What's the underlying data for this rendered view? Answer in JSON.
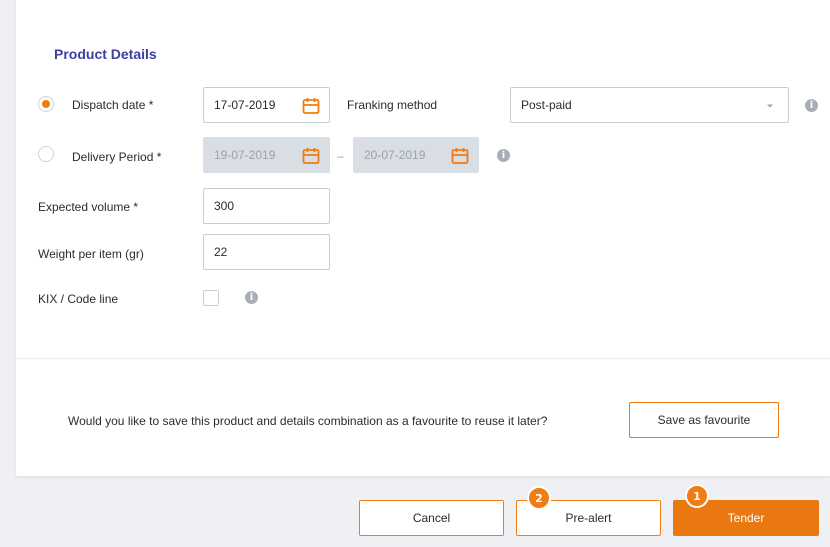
{
  "section": {
    "title": "Product Details"
  },
  "dispatch": {
    "label": "Dispatch date *",
    "value": "17-07-2019",
    "selected": true
  },
  "franking": {
    "label": "Franking method",
    "value": "Post-paid"
  },
  "delivery": {
    "label": "Delivery Period *",
    "from": "19-07-2019",
    "separator": "–",
    "to": "20-07-2019",
    "selected": false
  },
  "volume": {
    "label": "Expected volume *",
    "value": "300"
  },
  "weight": {
    "label": "Weight per item (gr)",
    "value": "22"
  },
  "kix": {
    "label": "KIX / Code line",
    "checked": false
  },
  "favourite": {
    "prompt": "Would you like to save this product and details combination as a favourite to reuse it later?",
    "button": "Save as favourite"
  },
  "actions": {
    "cancel": "Cancel",
    "prealert": "Pre-alert",
    "prealert_badge": "2",
    "tender": "Tender",
    "tender_badge": "1"
  },
  "icons": {
    "info": "i"
  },
  "colors": {
    "accent": "#f07c12",
    "title": "#3b3fa0",
    "disabled": "#d9dde4"
  }
}
